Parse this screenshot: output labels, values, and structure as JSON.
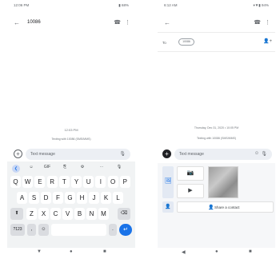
{
  "left_screen": {
    "status": {
      "time": "12:06 PM",
      "battery": "▮ 68%"
    },
    "appbar": {
      "back": "←",
      "title": "10086",
      "call_icon": "☎",
      "menu_icon": "⋮"
    },
    "conversation": {
      "time": "12:03 PM",
      "texting_note": "Texting with 10086 (SMS/MMS)"
    },
    "compose": {
      "plus": "+",
      "placeholder": "Text message",
      "mic": "🎙"
    },
    "keyboard": {
      "toolbar": [
        "❮",
        "☺",
        "GIF",
        "⎘",
        "⚙",
        "⋯",
        "🎙"
      ],
      "row1": [
        "Q",
        "W",
        "E",
        "R",
        "T",
        "Y",
        "U",
        "I",
        "O",
        "P"
      ],
      "row1_hints": [
        "1",
        "2",
        "3",
        "4",
        "5",
        "6",
        "7",
        "8",
        "9",
        "0"
      ],
      "row2": [
        "A",
        "S",
        "D",
        "F",
        "G",
        "H",
        "J",
        "K",
        "L"
      ],
      "row3": [
        "⬆",
        "Z",
        "X",
        "C",
        "V",
        "B",
        "N",
        "M",
        "⌫"
      ],
      "row4": [
        "?123",
        ",",
        "☺",
        "",
        ".",
        "↵"
      ]
    },
    "navbar": {
      "back": "▼",
      "home": "●",
      "recents": "■"
    }
  },
  "right_screen": {
    "status": {
      "time": "6:12 AM",
      "icons": "▾▼▮ 94%"
    },
    "appbar": {
      "back": "←",
      "call_icon": "☎",
      "menu_icon": "⋮"
    },
    "to_row": {
      "label": "To",
      "chip": "10086",
      "add_people_icon": "👤+"
    },
    "conversation": {
      "date_time": "Thursday, Dec 31, 2020 • 10:05 PM",
      "texting_note": "Texting with 10086 (SMS/MMS)"
    },
    "compose": {
      "plus": "+",
      "placeholder": "Text message",
      "emoji": "☺",
      "mic": "🎙"
    },
    "attach": {
      "gallery_icon": "🖼",
      "camera_icon": "📷",
      "video_icon": "▶",
      "contact_icon": "👤",
      "share_contact": "Share a contact"
    },
    "navbar": {
      "back": "◀",
      "home": "●",
      "recents": "■"
    }
  }
}
